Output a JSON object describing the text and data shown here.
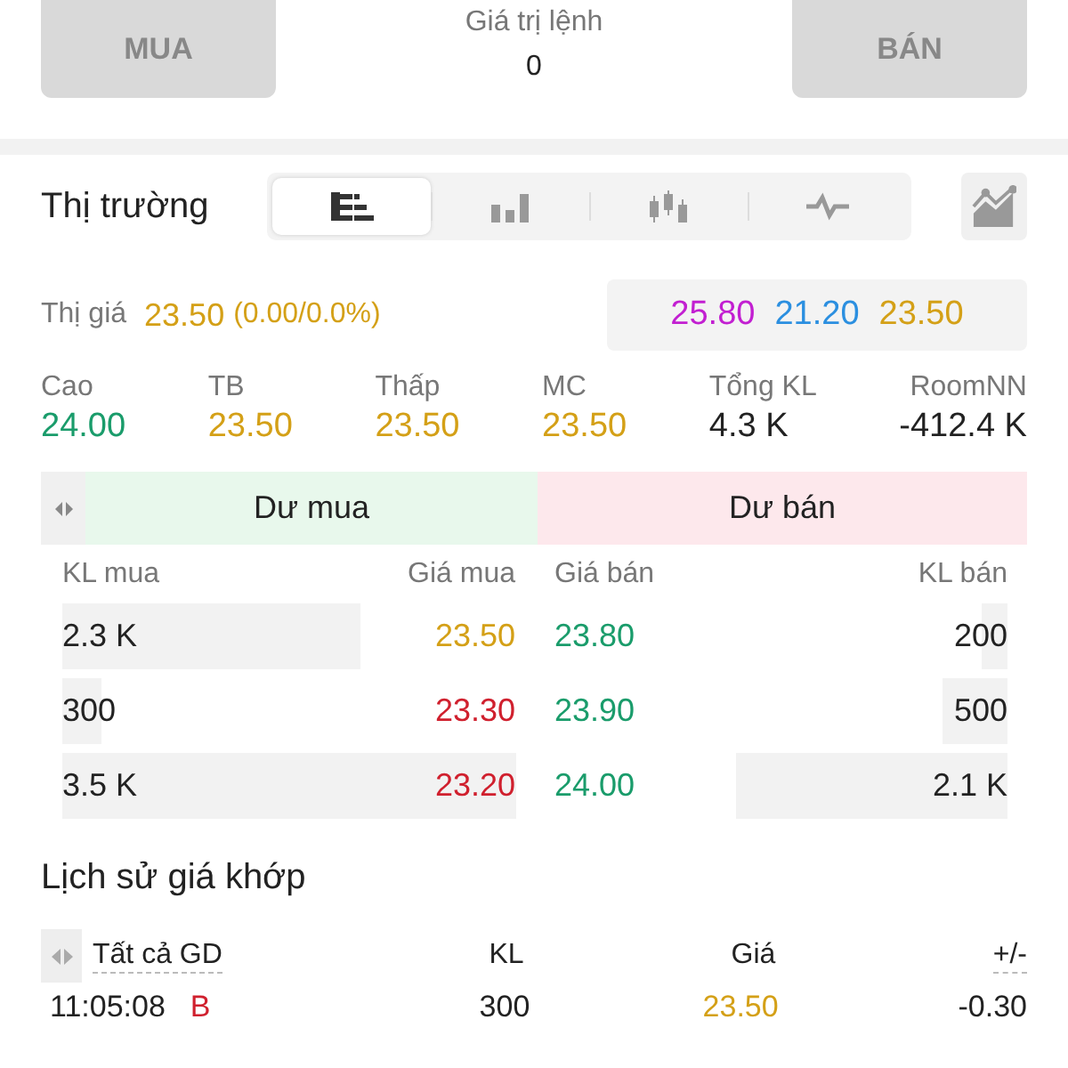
{
  "order_bar": {
    "buy_button": "MUA",
    "value_label": "Giá trị lệnh",
    "value": "0",
    "sell_button": "BÁN"
  },
  "market": {
    "title": "Thị trường",
    "tabs": [
      {
        "kind": "book",
        "selected": true
      },
      {
        "kind": "bars",
        "selected": false
      },
      {
        "kind": "candles",
        "selected": false
      },
      {
        "kind": "line",
        "selected": false
      }
    ]
  },
  "price": {
    "label": "Thị giá",
    "value": "23.50",
    "change": "(0.00/0.0%)",
    "color": "#d4a017"
  },
  "limits": [
    {
      "value": "25.80",
      "color": "#c21fd1"
    },
    {
      "value": "21.20",
      "color": "#2b8fe0"
    },
    {
      "value": "23.50",
      "color": "#d4a017"
    }
  ],
  "stats": [
    {
      "label": "Cao",
      "value": "24.00",
      "color": "#1a9c6b"
    },
    {
      "label": "TB",
      "value": "23.50",
      "color": "#d4a017"
    },
    {
      "label": "Thấp",
      "value": "23.50",
      "color": "#d4a017"
    },
    {
      "label": "MC",
      "value": "23.50",
      "color": "#d4a017"
    },
    {
      "label": "Tổng KL",
      "value": "4.3 K",
      "color": "#222222"
    },
    {
      "label": "RoomNN",
      "value": "-412.4 K",
      "color": "#222222"
    }
  ],
  "order_book": {
    "buy_title": "Dư mua",
    "sell_title": "Dư bán",
    "columns": [
      "KL mua",
      "Giá mua",
      "Giá bán",
      "KL bán"
    ],
    "rows": [
      {
        "buy": {
          "volume": "2.3 K",
          "price": "23.50",
          "color": "#d4a017"
        },
        "sell": {
          "volume": "200",
          "price": "23.80",
          "color": "#1a9c6b"
        }
      },
      {
        "buy": {
          "volume": "300",
          "price": "23.30",
          "color": "#d0202e"
        },
        "sell": {
          "volume": "500",
          "price": "23.90",
          "color": "#1a9c6b"
        }
      },
      {
        "buy": {
          "volume": "3.5 K",
          "price": "23.20",
          "color": "#d0202e"
        },
        "sell": {
          "volume": "2.1 K",
          "price": "24.00",
          "color": "#1a9c6b"
        }
      }
    ]
  },
  "history": {
    "title": "Lịch sử giá khớp",
    "columns": [
      "Tất cả GD",
      "KL",
      "Giá",
      "+/-"
    ],
    "rows": [
      {
        "time": "11:05:08",
        "side": "B",
        "volume": "300",
        "price": "23.50",
        "color": "#d4a017",
        "change": "-0.30"
      }
    ]
  }
}
